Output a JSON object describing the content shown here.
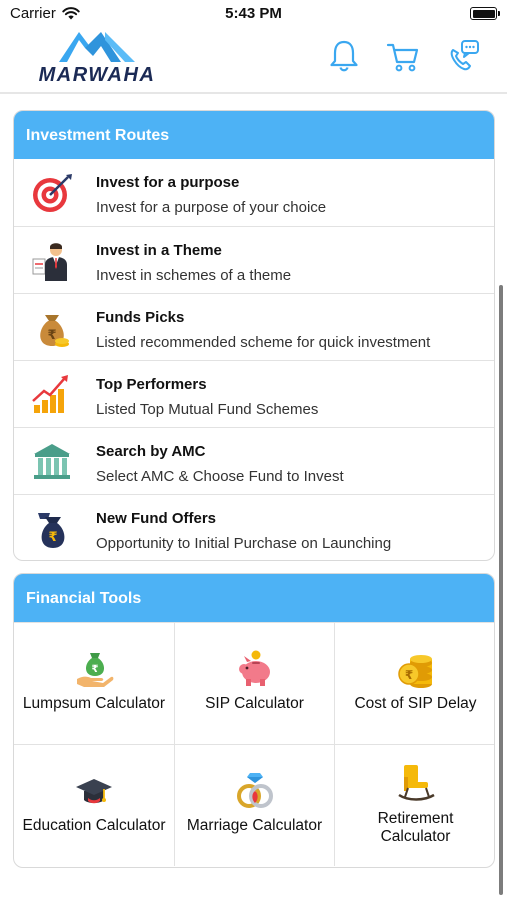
{
  "status_bar": {
    "carrier": "Carrier",
    "time": "5:43 PM",
    "icons": [
      "wifi-icon",
      "battery-icon"
    ]
  },
  "header": {
    "logo_text": "MARWAHA",
    "icons": [
      "bell-icon",
      "cart-icon",
      "phone-chat-icon"
    ],
    "accent_color": "#4db2f5"
  },
  "investment_routes": {
    "title": "Investment Routes",
    "items": [
      {
        "title": "Invest for a purpose",
        "subtitle": "Invest for a purpose of your choice",
        "icon": "target-icon"
      },
      {
        "title": "Invest in a Theme",
        "subtitle": "Invest in schemes of a theme",
        "icon": "businessman-icon"
      },
      {
        "title": "Funds Picks",
        "subtitle": "Listed recommended scheme for quick investment",
        "icon": "money-bag-icon"
      },
      {
        "title": "Top Performers",
        "subtitle": "Listed Top Mutual Fund Schemes",
        "icon": "growth-chart-icon"
      },
      {
        "title": "Search by AMC",
        "subtitle": "Select AMC & Choose Fund to Invest",
        "icon": "bank-icon"
      },
      {
        "title": "New Fund Offers",
        "subtitle": "Opportunity to Initial Purchase on Launching",
        "icon": "rupee-bag-icon"
      }
    ]
  },
  "financial_tools": {
    "title": "Financial Tools",
    "items": [
      {
        "label": "Lumpsum Calculator",
        "icon": "lumpsum-icon"
      },
      {
        "label": "SIP Calculator",
        "icon": "piggy-bank-icon"
      },
      {
        "label": "Cost of SIP Delay",
        "icon": "coins-icon"
      },
      {
        "label": "Education Calculator",
        "icon": "graduation-cap-icon"
      },
      {
        "label": "Marriage Calculator",
        "icon": "rings-icon"
      },
      {
        "label": "Retirement Calculator",
        "icon": "rocking-chair-icon"
      }
    ]
  }
}
